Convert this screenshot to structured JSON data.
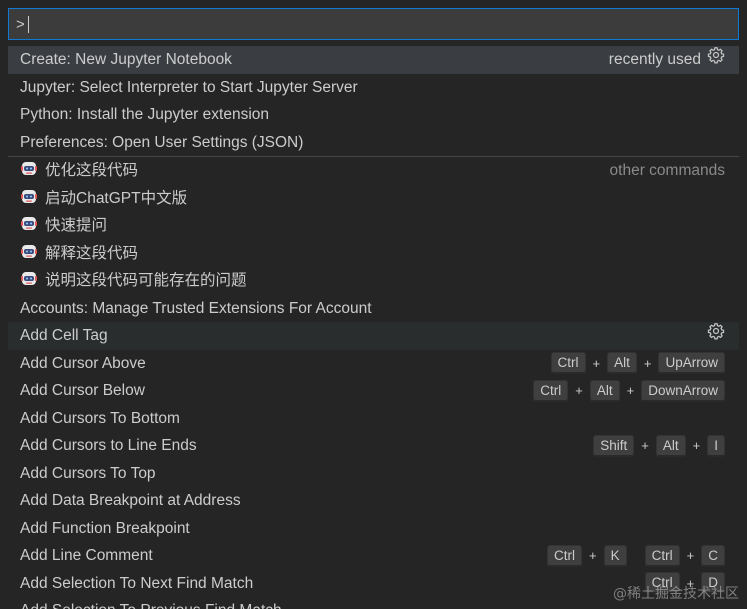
{
  "search": {
    "value": ">"
  },
  "rows": [
    {
      "label": "Create: New Jupyter Notebook",
      "right_text": "recently used",
      "gear": true
    },
    {
      "label": "Jupyter: Select Interpreter to Start Jupyter Server"
    },
    {
      "label": "Python: Install the Jupyter extension"
    },
    {
      "label": "Preferences: Open User Settings (JSON)"
    },
    {
      "label": "优化这段代码",
      "bot": true,
      "right_text": "other commands"
    },
    {
      "label": "启动ChatGPT中文版",
      "bot": true
    },
    {
      "label": "快速提问",
      "bot": true
    },
    {
      "label": "解释这段代码",
      "bot": true
    },
    {
      "label": "说明这段代码可能存在的问题",
      "bot": true
    },
    {
      "label": "Accounts: Manage Trusted Extensions For Account"
    },
    {
      "label": "Add Cell Tag",
      "gear": true
    },
    {
      "label": "Add Cursor Above",
      "keys": [
        [
          "Ctrl",
          "Alt",
          "UpArrow"
        ]
      ]
    },
    {
      "label": "Add Cursor Below",
      "keys": [
        [
          "Ctrl",
          "Alt",
          "DownArrow"
        ]
      ]
    },
    {
      "label": "Add Cursors To Bottom"
    },
    {
      "label": "Add Cursors to Line Ends",
      "keys": [
        [
          "Shift",
          "Alt",
          "I"
        ]
      ]
    },
    {
      "label": "Add Cursors To Top"
    },
    {
      "label": "Add Data Breakpoint at Address"
    },
    {
      "label": "Add Function Breakpoint"
    },
    {
      "label": "Add Line Comment",
      "keys": [
        [
          "Ctrl",
          "K"
        ],
        [
          "Ctrl",
          "C"
        ]
      ]
    },
    {
      "label": "Add Selection To Next Find Match",
      "keys": [
        [
          "Ctrl",
          "D"
        ]
      ]
    },
    {
      "label": "Add Selection To Previous Find Match"
    }
  ],
  "watermark": "@稀土掘金技术社区",
  "colors": {
    "background": "#252526",
    "focus_border": "#0e7ad3",
    "row_highlight": "#3a3d41"
  }
}
